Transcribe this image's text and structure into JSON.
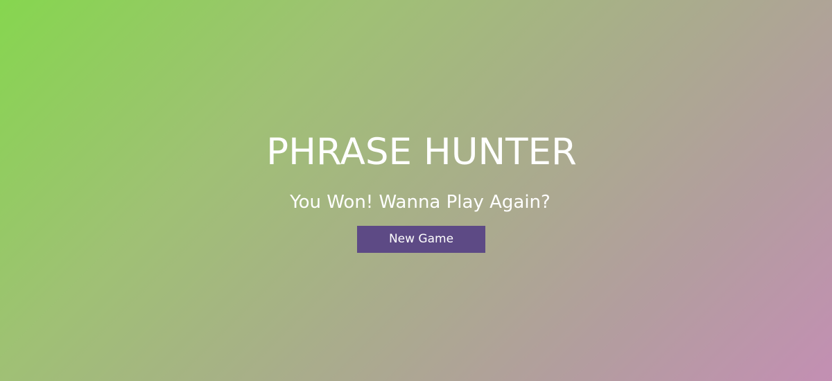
{
  "overlay": {
    "title": "PHRASE HUNTER",
    "message": "You Won! Wanna Play Again?",
    "button_label": "New Game"
  },
  "colors": {
    "gradient_start": "#86d64f",
    "gradient_end": "#c38fb3",
    "button_background": "#5d4a85",
    "text": "#ffffff"
  }
}
